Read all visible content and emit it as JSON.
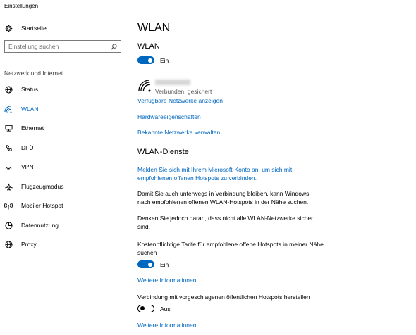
{
  "window": {
    "title": "Einstellungen"
  },
  "sidebar": {
    "home": "Startseite",
    "search_placeholder": "Einstellung suchen",
    "section": "Netzwerk und Internet",
    "items": [
      {
        "label": "Status",
        "icon": "globe-icon"
      },
      {
        "label": "WLAN",
        "icon": "wifi-icon",
        "active": true
      },
      {
        "label": "Ethernet",
        "icon": "ethernet-icon"
      },
      {
        "label": "DFÜ",
        "icon": "dialup-icon"
      },
      {
        "label": "VPN",
        "icon": "vpn-icon"
      },
      {
        "label": "Flugzeugmodus",
        "icon": "airplane-icon"
      },
      {
        "label": "Mobiler Hotspot",
        "icon": "hotspot-icon"
      },
      {
        "label": "Datennutzung",
        "icon": "data-usage-icon"
      },
      {
        "label": "Proxy",
        "icon": "globe-icon"
      }
    ]
  },
  "main": {
    "title": "WLAN",
    "wlan_heading": "WLAN",
    "wlan_toggle": {
      "state": "on",
      "label": "Ein"
    },
    "network": {
      "status": "Verbunden, gesichert"
    },
    "links": {
      "show_networks": "Verfügbare Netzwerke anzeigen",
      "hardware": "Hardwareeigenschaften",
      "manage_known": "Bekannte Netzwerke verwalten"
    },
    "services_heading": "WLAN-Dienste",
    "signin_link": "Melden Sie sich mit Ihrem Microsoft-Konto an, um sich mit empfohlenen offenen Hotspots zu verbinden.",
    "para1": "Damit Sie auch unterwegs in Verbindung bleiben, kann Windows nach empfohlenen offenen WLAN-Hotspots in der Nähe suchen.",
    "para2": "Denken Sie jedoch daran, dass nicht alle WLAN-Netzwerke sicher sind.",
    "paid_label": "Kostenpflichtige Tarife für empfohlene offene Hotspots in meiner Nähe suchen",
    "paid_toggle": {
      "state": "on",
      "label": "Ein"
    },
    "more_info_1": "Weitere Informationen",
    "suggested_label": "Verbindung mit vorgeschlagenen öffentlichen Hotspots herstellen",
    "suggested_toggle": {
      "state": "off",
      "label": "Aus"
    },
    "more_info_2": "Weitere Informationen"
  },
  "colors": {
    "accent": "#0067c0",
    "text": "#000000",
    "muted": "#5a5a5a"
  }
}
